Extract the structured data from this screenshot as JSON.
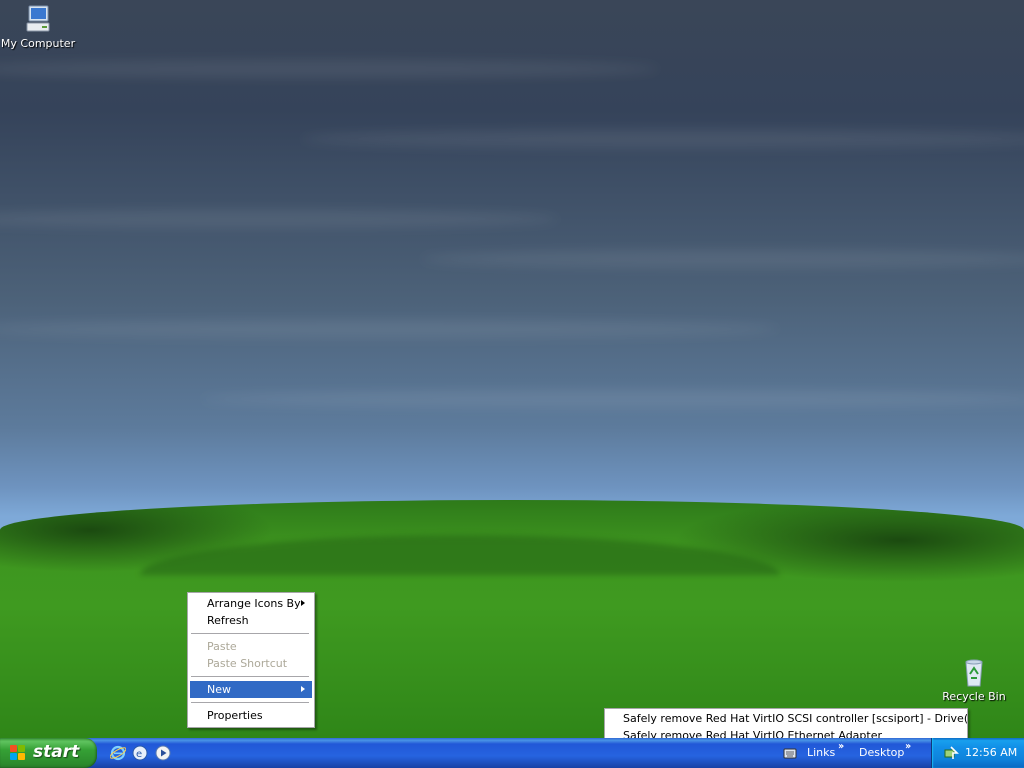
{
  "desktop": {
    "icons": [
      {
        "label": "My Computer",
        "icon": "my-computer-icon"
      },
      {
        "label": "Recycle Bin",
        "icon": "recycle-bin-icon"
      }
    ]
  },
  "context_menu": {
    "items": [
      {
        "label": "Arrange Icons By",
        "submenu": true,
        "enabled": true
      },
      {
        "label": "Refresh",
        "enabled": true
      },
      {
        "label": "Paste",
        "enabled": false
      },
      {
        "label": "Paste Shortcut",
        "enabled": false
      },
      {
        "label": "New",
        "submenu": true,
        "enabled": true,
        "highlighted": true
      },
      {
        "label": "Properties",
        "enabled": true
      }
    ]
  },
  "tray_popup": {
    "items": [
      "Safely remove Red Hat VirtIO SCSI controller [scsiport] - Drive(C:)",
      "Safely remove Red Hat VirtIO Ethernet Adapter"
    ]
  },
  "taskbar": {
    "start_label": "start",
    "quick_launch": [
      "internet-explorer-icon",
      "show-desktop-icon",
      "media-player-icon"
    ],
    "toolbars": [
      "Links",
      "Desktop"
    ],
    "tray": {
      "clock": "12:56 AM",
      "icon": "safely-remove-hardware-icon"
    }
  },
  "colors": {
    "highlight": "#316ac5",
    "taskbar": "#245edb",
    "start": "#3c9d3c",
    "tray": "#0f8fe6"
  }
}
